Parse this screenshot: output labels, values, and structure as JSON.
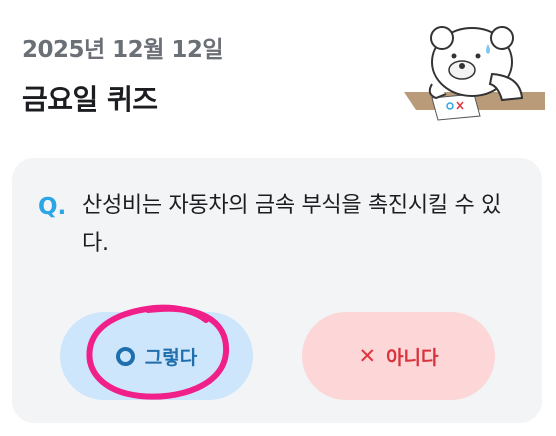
{
  "header": {
    "date": "2025년 12월 12일",
    "title": "금요일 퀴즈"
  },
  "quiz": {
    "q_label": "Q.",
    "question": "산성비는 자동차의 금속 부식을 촉진시킬 수 있다."
  },
  "answers": {
    "yes_label": "그렇다",
    "no_label": "아니다",
    "yes_icon": "o-icon",
    "no_icon": "x-icon"
  },
  "colors": {
    "accent": "#2aa6e6",
    "yes_bg": "#cde6fb",
    "no_bg": "#fdd6d8",
    "annotation": "#f01f8a"
  }
}
